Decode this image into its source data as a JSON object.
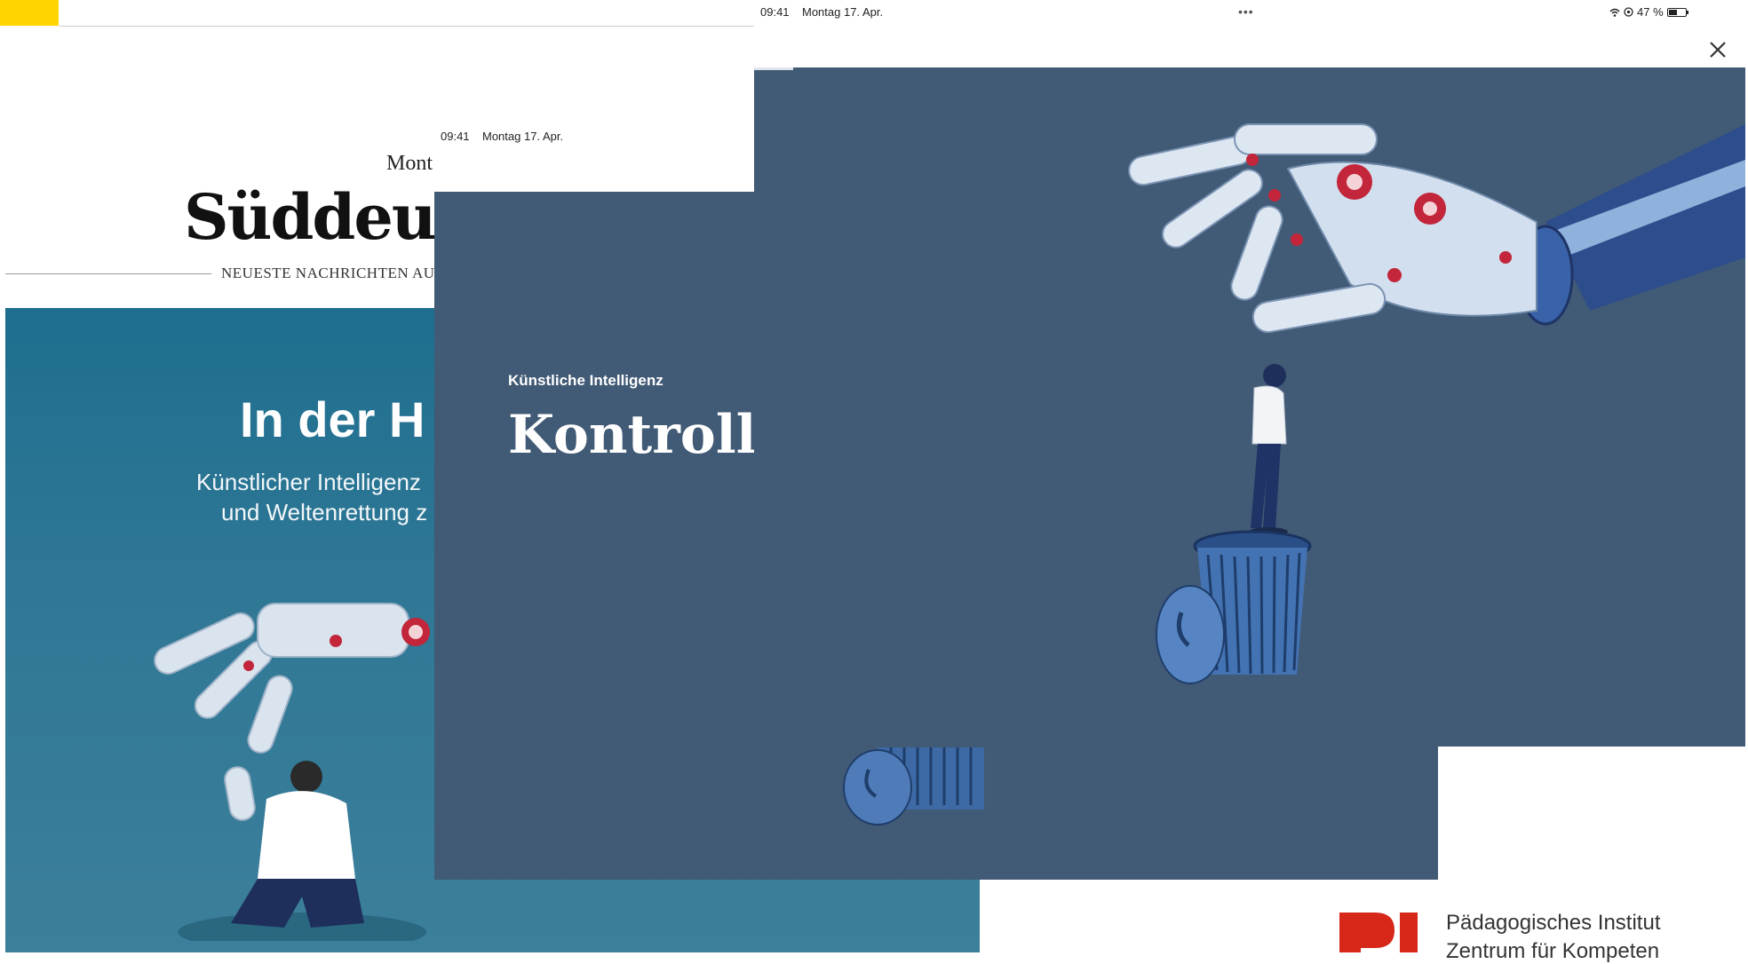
{
  "back_page": {
    "date": "Mont",
    "masthead": "Süddeut",
    "tagline": "NEUESTE NACHRICHTEN AUS",
    "hero": {
      "title": "In der H",
      "subtitle_line1": "Künstlicher Intelligenz",
      "subtitle_line2": "und Weltenrettung z"
    }
  },
  "article_card": {
    "status_time": "09:41",
    "status_date": "Montag 17. Apr.",
    "kicker": "Künstliche Intelligenz",
    "headline": "Kontrollve"
  },
  "modal": {
    "status_time": "09:41",
    "status_date": "Montag 17. Apr.",
    "status_dots": "•••",
    "battery_percent": "47 %",
    "close_icon": "close-icon"
  },
  "logo": {
    "line1": "Pädagogisches Institut",
    "line2": "Zentrum für Kompeten"
  },
  "colors": {
    "accent_yellow": "#ffd400",
    "panel_slate": "#415a75",
    "panel_teal": "#2f7895",
    "logo_red": "#d62718"
  },
  "icons": {
    "wifi": "wifi-icon",
    "location": "location-icon",
    "battery": "battery-icon"
  }
}
